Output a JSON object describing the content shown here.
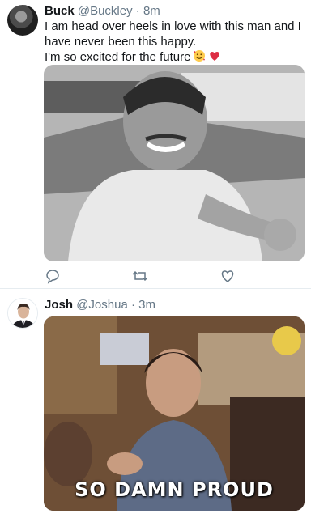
{
  "tweets": [
    {
      "name": "Buck",
      "handle": "@Buckley",
      "time": "8m",
      "lines": [
        "I am head over heels in love with this man and I",
        "have never been this happy.",
        "I'm so excited for the future"
      ],
      "emojis": [
        "smiling-face-with-hearts",
        "red-heart"
      ],
      "media": {
        "kind": "black-and-white photo of a smiling man"
      },
      "actions": [
        "reply-icon",
        "retweet-icon",
        "like-icon"
      ]
    },
    {
      "name": "Josh",
      "handle": "@Joshua",
      "time": "3m",
      "media": {
        "kind": "gif",
        "caption": "SO DAMN PROUD"
      }
    }
  ],
  "separator": "·",
  "colors": {
    "text": "#14171a",
    "secondary": "#657786",
    "divider": "#e6ecf0",
    "heart": "#e0245e"
  }
}
